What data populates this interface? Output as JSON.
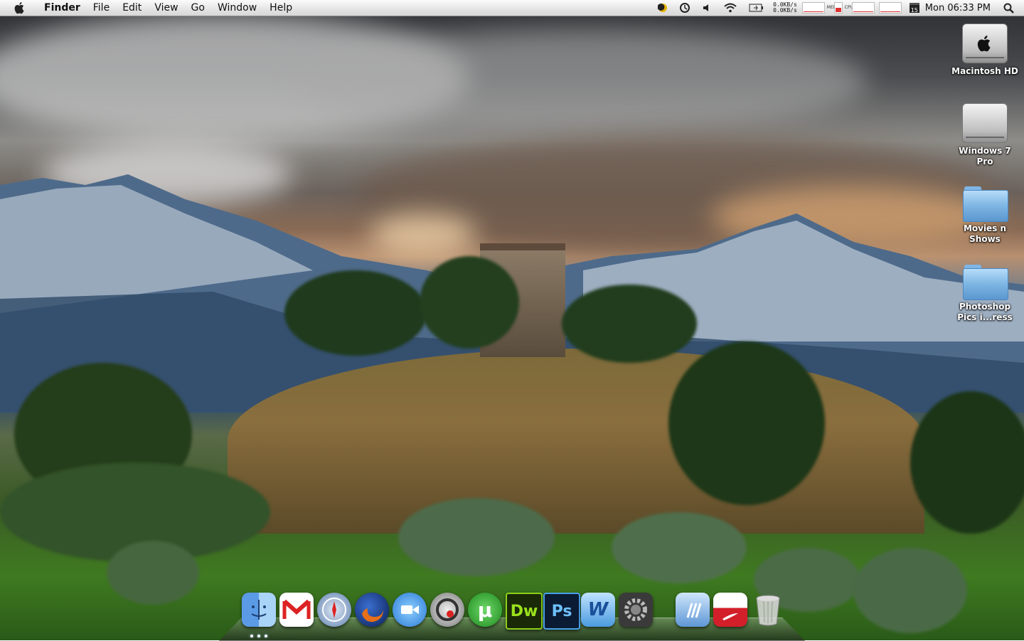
{
  "menubar": {
    "apple_icon": "apple-icon",
    "app_name": "Finder",
    "menus": [
      "File",
      "Edit",
      "View",
      "Go",
      "Window",
      "Help"
    ],
    "net_up": "0.0KB/s",
    "net_down": "0.0KB/s",
    "mem_label": "MEM",
    "cpu_label": "CPU",
    "calendar_day": "15",
    "clock": "Mon 06:33 PM",
    "status_icons": [
      "moon-icon",
      "time-machine-icon",
      "volume-icon",
      "wifi-icon",
      "battery-icon",
      "calendar-icon",
      "spotlight-icon"
    ]
  },
  "desktop": {
    "icons": [
      {
        "label": "Macintosh HD",
        "type": "hard-drive"
      },
      {
        "label": "Windows 7 Pro",
        "type": "hard-drive"
      },
      {
        "label": "Movies n Shows",
        "type": "folder"
      },
      {
        "label": "Photoshop Pics i...ress",
        "type": "folder"
      }
    ]
  },
  "dock": {
    "items": [
      {
        "name": "finder-icon",
        "running": true
      },
      {
        "name": "gmail-icon"
      },
      {
        "name": "safari-icon"
      },
      {
        "name": "firefox-icon"
      },
      {
        "name": "ichat-icon"
      },
      {
        "name": "itunes-icon"
      },
      {
        "name": "utorrent-icon",
        "text": "µ"
      },
      {
        "name": "dreamweaver-icon",
        "text": "Dw"
      },
      {
        "name": "photoshop-icon",
        "text": "Ps"
      },
      {
        "name": "microsoft-word-icon",
        "text": "W"
      },
      {
        "name": "system-preferences-icon"
      },
      {
        "name": "applications-stack-icon"
      },
      {
        "name": "documents-stack-icon"
      },
      {
        "name": "trash-icon"
      }
    ]
  }
}
